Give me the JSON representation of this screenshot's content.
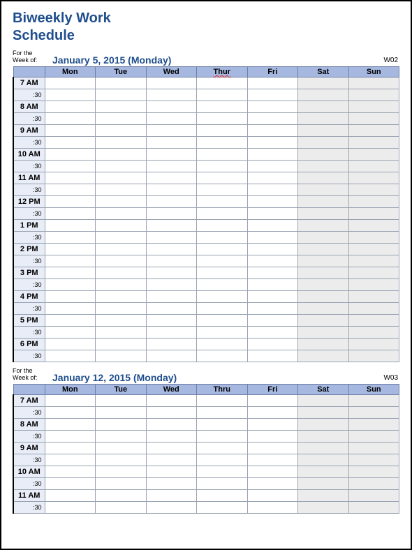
{
  "title_line1": "Biweekly Work",
  "title_line2": "Schedule",
  "week_prefix_label": "For the\nWeek of:",
  "weeks": [
    {
      "date_text": "January 5, 2015 (Monday)",
      "week_num": "W02",
      "days": [
        "Mon",
        "Tue",
        "Wed",
        "Thur",
        "Fri",
        "Sat",
        "Sun"
      ],
      "spell_day_index": 3,
      "times": [
        "7 AM",
        "8 AM",
        "9 AM",
        "10 AM",
        "11 AM",
        "12 PM",
        "1 PM",
        "2 PM",
        "3 PM",
        "4 PM",
        "5 PM",
        "6 PM"
      ],
      "half_label": ":30"
    },
    {
      "date_text": "January 12, 2015 (Monday)",
      "week_num": "W03",
      "days": [
        "Mon",
        "Tue",
        "Wed",
        "Thru",
        "Fri",
        "Sat",
        "Sun"
      ],
      "spell_day_index": -1,
      "times": [
        "7 AM",
        "8 AM",
        "9 AM",
        "10 AM",
        "11 AM"
      ],
      "half_label": ":30"
    }
  ],
  "weekend_indices": [
    5,
    6
  ]
}
